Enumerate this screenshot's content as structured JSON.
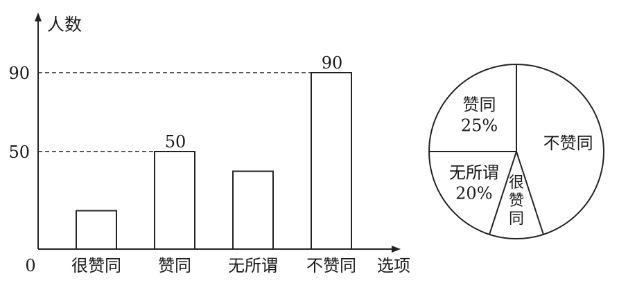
{
  "chart_data": [
    {
      "type": "bar",
      "categories": [
        "很赞同",
        "赞同",
        "无所谓",
        "不赞同"
      ],
      "values": [
        20,
        50,
        40,
        90
      ],
      "xlabel": "选项",
      "ylabel": "人数",
      "origin_label": "0",
      "yticks": [
        50,
        90
      ],
      "ylim": [
        0,
        110
      ],
      "data_labels": [
        "",
        "50",
        "",
        "90"
      ],
      "grid": false
    },
    {
      "type": "pie",
      "slices": [
        {
          "name": "赞同",
          "label": "赞同",
          "percent_label": "25%",
          "value": 25
        },
        {
          "name": "无所谓",
          "label": "无所谓",
          "percent_label": "20%",
          "value": 20
        },
        {
          "name": "很赞同",
          "label": "很赞同",
          "percent_label": "",
          "value": 10
        },
        {
          "name": "不赞同",
          "label": "不赞同",
          "percent_label": "",
          "value": 45
        }
      ]
    }
  ]
}
